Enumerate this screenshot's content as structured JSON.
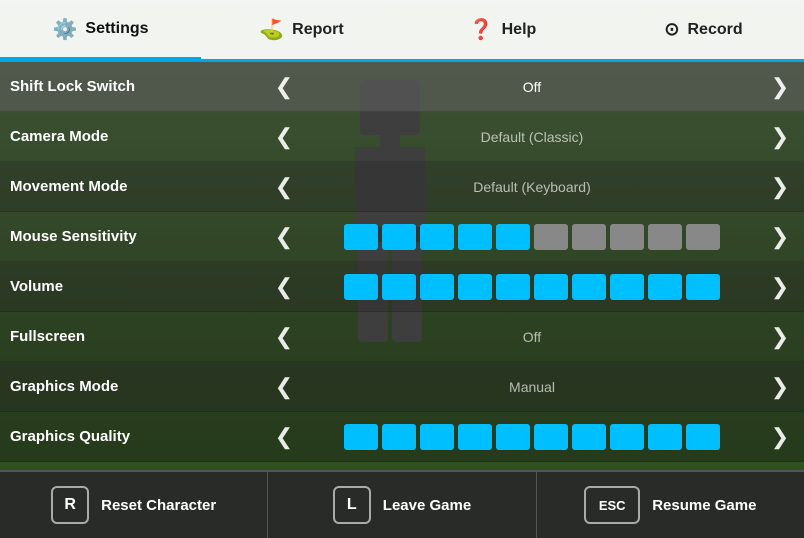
{
  "nav": {
    "items": [
      {
        "id": "settings",
        "label": "Settings",
        "icon": "⚙️",
        "active": true
      },
      {
        "id": "report",
        "label": "Report",
        "icon": "🚩"
      },
      {
        "id": "help",
        "label": "Help",
        "icon": "❓"
      },
      {
        "id": "record",
        "label": "Record",
        "icon": "⊙"
      }
    ]
  },
  "settings": [
    {
      "id": "shift-lock",
      "label": "Shift Lock Switch",
      "type": "toggle",
      "value": "Off"
    },
    {
      "id": "camera-mode",
      "label": "Camera Mode",
      "type": "toggle",
      "value": "Default (Classic)"
    },
    {
      "id": "movement-mode",
      "label": "Movement Mode",
      "type": "toggle",
      "value": "Default (Keyboard)"
    },
    {
      "id": "mouse-sensitivity",
      "label": "Mouse Sensitivity",
      "type": "slider",
      "activeBlocks": 5,
      "totalBlocks": 10
    },
    {
      "id": "volume",
      "label": "Volume",
      "type": "slider",
      "activeBlocks": 10,
      "totalBlocks": 10
    },
    {
      "id": "fullscreen",
      "label": "Fullscreen",
      "type": "toggle",
      "value": "Off"
    },
    {
      "id": "graphics-mode",
      "label": "Graphics Mode",
      "type": "toggle",
      "value": "Manual"
    },
    {
      "id": "graphics-quality",
      "label": "Graphics Quality",
      "type": "slider",
      "activeBlocks": 10,
      "totalBlocks": 10
    }
  ],
  "bottomBar": {
    "buttons": [
      {
        "id": "reset",
        "key": "R",
        "label": "Reset Character",
        "wide": false
      },
      {
        "id": "leave",
        "key": "L",
        "label": "Leave Game",
        "wide": false
      },
      {
        "id": "resume",
        "key": "ESC",
        "label": "Resume Game",
        "wide": true
      }
    ]
  },
  "colors": {
    "active_block": "#00bfff",
    "inactive_block": "#777",
    "nav_active_underline": "#00a8e8"
  }
}
